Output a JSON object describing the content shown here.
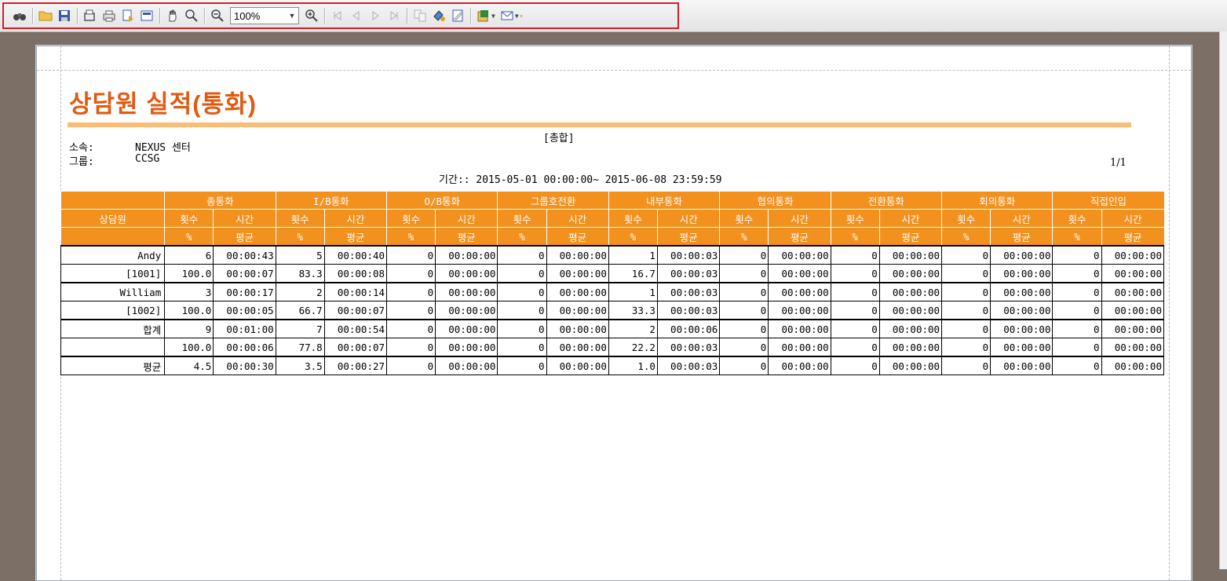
{
  "toolbar": {
    "icons": [
      "binoculars-icon",
      "open-folder-icon",
      "save-icon",
      "print-setup-icon",
      "print-icon",
      "export-icon",
      "page-layout-icon",
      "hand-icon",
      "magnifier-icon",
      "zoom-out-icon",
      "zoom-in-icon",
      "first-page-icon",
      "prev-page-icon",
      "next-page-icon",
      "last-page-icon",
      "multi-page-icon",
      "paint-icon",
      "watermark-icon",
      "export-excel-icon",
      "email-icon"
    ],
    "zoom_value": "100%"
  },
  "report": {
    "title": "상담원 실적(통화)",
    "summary_label": "[총합]",
    "affiliation_label": "소속:",
    "affiliation_value": "NEXUS 센터",
    "group_label": "그룹:",
    "group_value": "CCSG",
    "period": "기간:: 2015-05-01 00:00:00~ 2015-06-08 23:59:59",
    "page_number": "1/1"
  },
  "table": {
    "header1": [
      "총통화",
      "I/B통화",
      "O/B통화",
      "그룹호전환",
      "내부통화",
      "협의통화",
      "전환통화",
      "회의통화",
      "직접인입"
    ],
    "agent_header": "상담원",
    "sub_count": "횟수",
    "sub_time": "시간",
    "sub_pct": "%",
    "sub_avg": "평균",
    "rows": [
      {
        "name": "Andy",
        "cells": [
          "6",
          "00:00:43",
          "5",
          "00:00:40",
          "0",
          "00:00:00",
          "0",
          "00:00:00",
          "1",
          "00:00:03",
          "0",
          "00:00:00",
          "0",
          "00:00:00",
          "0",
          "00:00:00",
          "0",
          "00:00:00"
        ]
      },
      {
        "name": "[1001]",
        "cells": [
          "100.0",
          "00:00:07",
          "83.3",
          "00:00:08",
          "0",
          "00:00:00",
          "0",
          "00:00:00",
          "16.7",
          "00:00:03",
          "0",
          "00:00:00",
          "0",
          "00:00:00",
          "0",
          "00:00:00",
          "0",
          "00:00:00"
        ]
      },
      {
        "name": "William",
        "cells": [
          "3",
          "00:00:17",
          "2",
          "00:00:14",
          "0",
          "00:00:00",
          "0",
          "00:00:00",
          "1",
          "00:00:03",
          "0",
          "00:00:00",
          "0",
          "00:00:00",
          "0",
          "00:00:00",
          "0",
          "00:00:00"
        ]
      },
      {
        "name": "[1002]",
        "cells": [
          "100.0",
          "00:00:05",
          "66.7",
          "00:00:07",
          "0",
          "00:00:00",
          "0",
          "00:00:00",
          "33.3",
          "00:00:03",
          "0",
          "00:00:00",
          "0",
          "00:00:00",
          "0",
          "00:00:00",
          "0",
          "00:00:00"
        ]
      },
      {
        "name": "합계",
        "cells": [
          "9",
          "00:01:00",
          "7",
          "00:00:54",
          "0",
          "00:00:00",
          "0",
          "00:00:00",
          "2",
          "00:00:06",
          "0",
          "00:00:00",
          "0",
          "00:00:00",
          "0",
          "00:00:00",
          "0",
          "00:00:00"
        ]
      },
      {
        "name": "",
        "cells": [
          "100.0",
          "00:00:06",
          "77.8",
          "00:00:07",
          "0",
          "00:00:00",
          "0",
          "00:00:00",
          "22.2",
          "00:00:03",
          "0",
          "00:00:00",
          "0",
          "00:00:00",
          "0",
          "00:00:00",
          "0",
          "00:00:00"
        ]
      },
      {
        "name": "평균",
        "cells": [
          "4.5",
          "00:00:30",
          "3.5",
          "00:00:27",
          "0",
          "00:00:00",
          "0",
          "00:00:00",
          "1.0",
          "00:00:03",
          "0",
          "00:00:00",
          "0",
          "00:00:00",
          "0",
          "00:00:00",
          "0",
          "00:00:00"
        ]
      }
    ]
  },
  "colors": {
    "title": "#e05a10",
    "header_bg": "#f3911f",
    "rule": "#fbbc73",
    "toolbar_highlight": "#cc1f2a"
  }
}
